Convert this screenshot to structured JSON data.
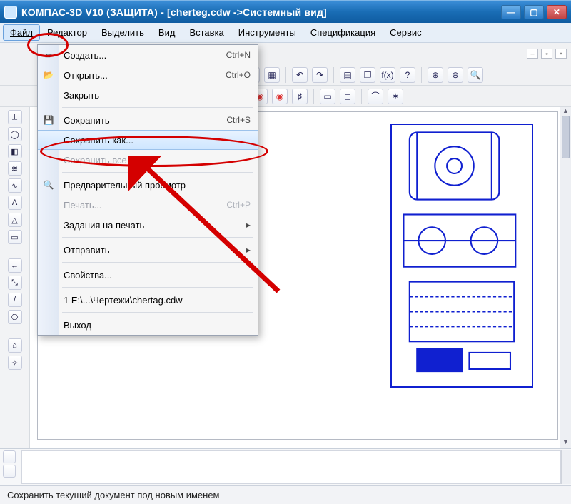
{
  "title": "КОМПАС-3D V10 (ЗАЩИТА) - [cherteg.cdw ->Системный вид]",
  "menubar": {
    "file": "Файл",
    "edit": "Редактор",
    "select": "Выделить",
    "view": "Вид",
    "insert": "Вставка",
    "tools": "Инструменты",
    "spec": "Спецификация",
    "service": "Сервис"
  },
  "dropdown": {
    "new": {
      "label": "Создать...",
      "shortcut": "Ctrl+N"
    },
    "open": {
      "label": "Открыть...",
      "shortcut": "Ctrl+O"
    },
    "close": {
      "label": "Закрыть",
      "shortcut": ""
    },
    "save": {
      "label": "Сохранить",
      "shortcut": "Ctrl+S"
    },
    "saveas": {
      "label": "Сохранить как...",
      "shortcut": ""
    },
    "saveall": {
      "label": "Сохранить все",
      "shortcut": ""
    },
    "preview": {
      "label": "Предварительный просмотр",
      "shortcut": ""
    },
    "print": {
      "label": "Печать...",
      "shortcut": "Ctrl+P"
    },
    "printjobs": {
      "label": "Задания на печать",
      "shortcut": ""
    },
    "send": {
      "label": "Отправить",
      "shortcut": ""
    },
    "props": {
      "label": "Свойства...",
      "shortcut": ""
    },
    "recent": {
      "label": "1 E:\\...\\Чертежи\\chertag.cdw",
      "shortcut": ""
    },
    "exit": {
      "label": "Выход",
      "shortcut": ""
    }
  },
  "toolbar2_icons": {
    "brush": "🖌",
    "grid": "▦",
    "undo": "↶",
    "redo": "↷",
    "pal": "▤",
    "obj": "❐",
    "fx": "f(x)",
    "help": "?",
    "zoomin": "⊕",
    "zoomout": "⊖",
    "zoomwin": "🔍"
  },
  "toolbar3_icons": {
    "g1": "◉",
    "g2": "◉",
    "grid": "♯",
    "a": "▭",
    "b": "◻",
    "c": "⌒",
    "d": "✶"
  },
  "statusbar": "Сохранить текущий документ под новым именем"
}
